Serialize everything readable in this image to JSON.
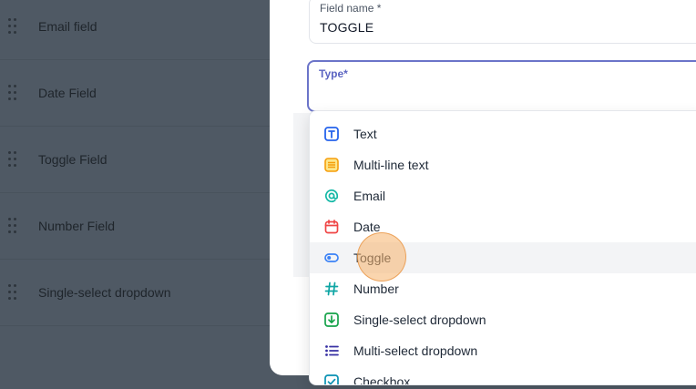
{
  "background_list": {
    "items": [
      {
        "label": "Email field"
      },
      {
        "label": "Date Field"
      },
      {
        "label": "Toggle Field"
      },
      {
        "label": "Number Field"
      },
      {
        "label": "Single-select dropdown"
      }
    ]
  },
  "form": {
    "field_name_label": "Field name *",
    "field_name_value": "TOGGLE",
    "type_label": "Type*",
    "type_value": ""
  },
  "dropdown": {
    "hovered_index": 4,
    "options": [
      {
        "label": "Text",
        "icon": "text-icon",
        "color": "#2563eb"
      },
      {
        "label": "Multi-line text",
        "icon": "multiline-text-icon",
        "color": "#f59e0b"
      },
      {
        "label": "Email",
        "icon": "at-sign-icon",
        "color": "#14b8a6"
      },
      {
        "label": "Date",
        "icon": "calendar-icon",
        "color": "#ef4444"
      },
      {
        "label": "Toggle",
        "icon": "toggle-icon",
        "color": "#3b82f6"
      },
      {
        "label": "Number",
        "icon": "hash-icon",
        "color": "#0ea5a4"
      },
      {
        "label": "Single-select dropdown",
        "icon": "single-select-icon",
        "color": "#16a34a"
      },
      {
        "label": "Multi-select dropdown",
        "icon": "multi-select-icon",
        "color": "#3730a3"
      },
      {
        "label": "Checkbox",
        "icon": "checkbox-icon",
        "color": "#0891b2"
      }
    ]
  }
}
